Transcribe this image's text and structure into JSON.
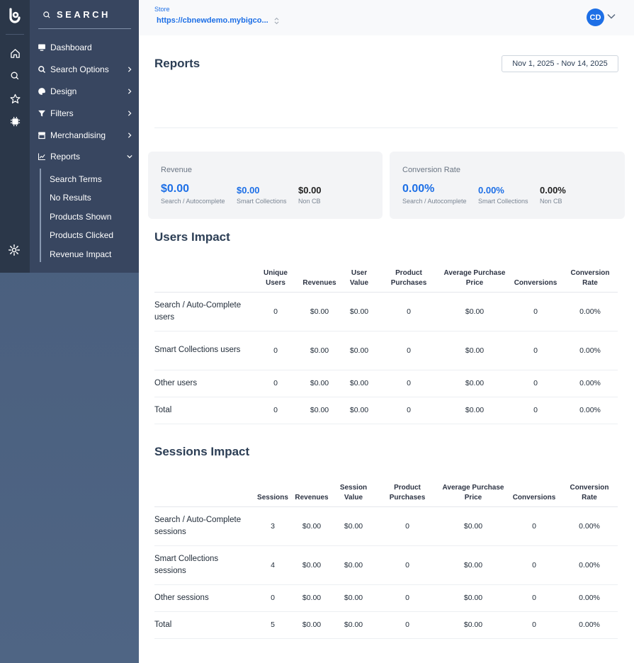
{
  "brand": {
    "name": "SEARCH"
  },
  "sidebar": {
    "items": [
      {
        "label": "Dashboard",
        "icon": "monitor-icon",
        "has_chevron": false
      },
      {
        "label": "Search Options",
        "icon": "search-icon",
        "has_chevron": true
      },
      {
        "label": "Design",
        "icon": "palette-icon",
        "has_chevron": true
      },
      {
        "label": "Filters",
        "icon": "filter-icon",
        "has_chevron": true
      },
      {
        "label": "Merchandising",
        "icon": "store-icon",
        "has_chevron": true
      },
      {
        "label": "Reports",
        "icon": "chart-line-icon",
        "has_chevron": true,
        "expanded": true
      }
    ],
    "sub_items": [
      "Search Terms",
      "No Results",
      "Products Shown",
      "Products Clicked",
      "Revenue Impact"
    ]
  },
  "header": {
    "store_label": "Store",
    "store_value": "https://cbnewdemo.mybigco...",
    "avatar_initials": "CD"
  },
  "main": {
    "title": "Reports",
    "date_range": "Nov 1, 2025 - Nov 14, 2025"
  },
  "revenue_card": {
    "title": "Revenue",
    "metrics": [
      {
        "value": "$0.00",
        "label": "Search / Autocomplete"
      },
      {
        "value": "$0.00",
        "label": "Smart Collections"
      },
      {
        "value": "$0.00",
        "label": "Non CB"
      }
    ]
  },
  "conversion_card": {
    "title": "Conversion Rate",
    "metrics": [
      {
        "value": "0.00%",
        "label": "Search / Autocomplete"
      },
      {
        "value": "0.00%",
        "label": "Smart Collections"
      },
      {
        "value": "0.00%",
        "label": "Non CB"
      }
    ]
  },
  "users_impact": {
    "title": "Users Impact",
    "headers": [
      "",
      "Unique Users",
      "Revenues",
      "User Value",
      "Product Purchases",
      "Average Purchase Price",
      "Conversions",
      "Conversion Rate"
    ],
    "rows": [
      [
        "Search / Auto-Complete users",
        "0",
        "$0.00",
        "$0.00",
        "0",
        "$0.00",
        "0",
        "0.00%"
      ],
      [
        "Smart Collections users",
        "0",
        "$0.00",
        "$0.00",
        "0",
        "$0.00",
        "0",
        "0.00%"
      ],
      [
        "Other users",
        "0",
        "$0.00",
        "$0.00",
        "0",
        "$0.00",
        "0",
        "0.00%"
      ],
      [
        "Total",
        "0",
        "$0.00",
        "$0.00",
        "0",
        "$0.00",
        "0",
        "0.00%"
      ]
    ]
  },
  "sessions_impact": {
    "title": "Sessions Impact",
    "headers": [
      "",
      "Sessions",
      "Revenues",
      "Session Value",
      "Product Purchases",
      "Average Purchase Price",
      "Conversions",
      "Conversion Rate"
    ],
    "rows": [
      [
        "Search / Auto-Complete sessions",
        "3",
        "$0.00",
        "$0.00",
        "0",
        "$0.00",
        "0",
        "0.00%"
      ],
      [
        "Smart Collections sessions",
        "4",
        "$0.00",
        "$0.00",
        "0",
        "$0.00",
        "0",
        "0.00%"
      ],
      [
        "Other sessions",
        "0",
        "$0.00",
        "$0.00",
        "0",
        "$0.00",
        "0",
        "0.00%"
      ],
      [
        "Total",
        "5",
        "$0.00",
        "$0.00",
        "0",
        "$0.00",
        "0",
        "0.00%"
      ]
    ]
  },
  "colors": {
    "accent": "#1d6fe6",
    "sidebar_dark": "#2b3749",
    "sidebar_panel": "#384660",
    "card_bg": "#f3f4f6"
  }
}
